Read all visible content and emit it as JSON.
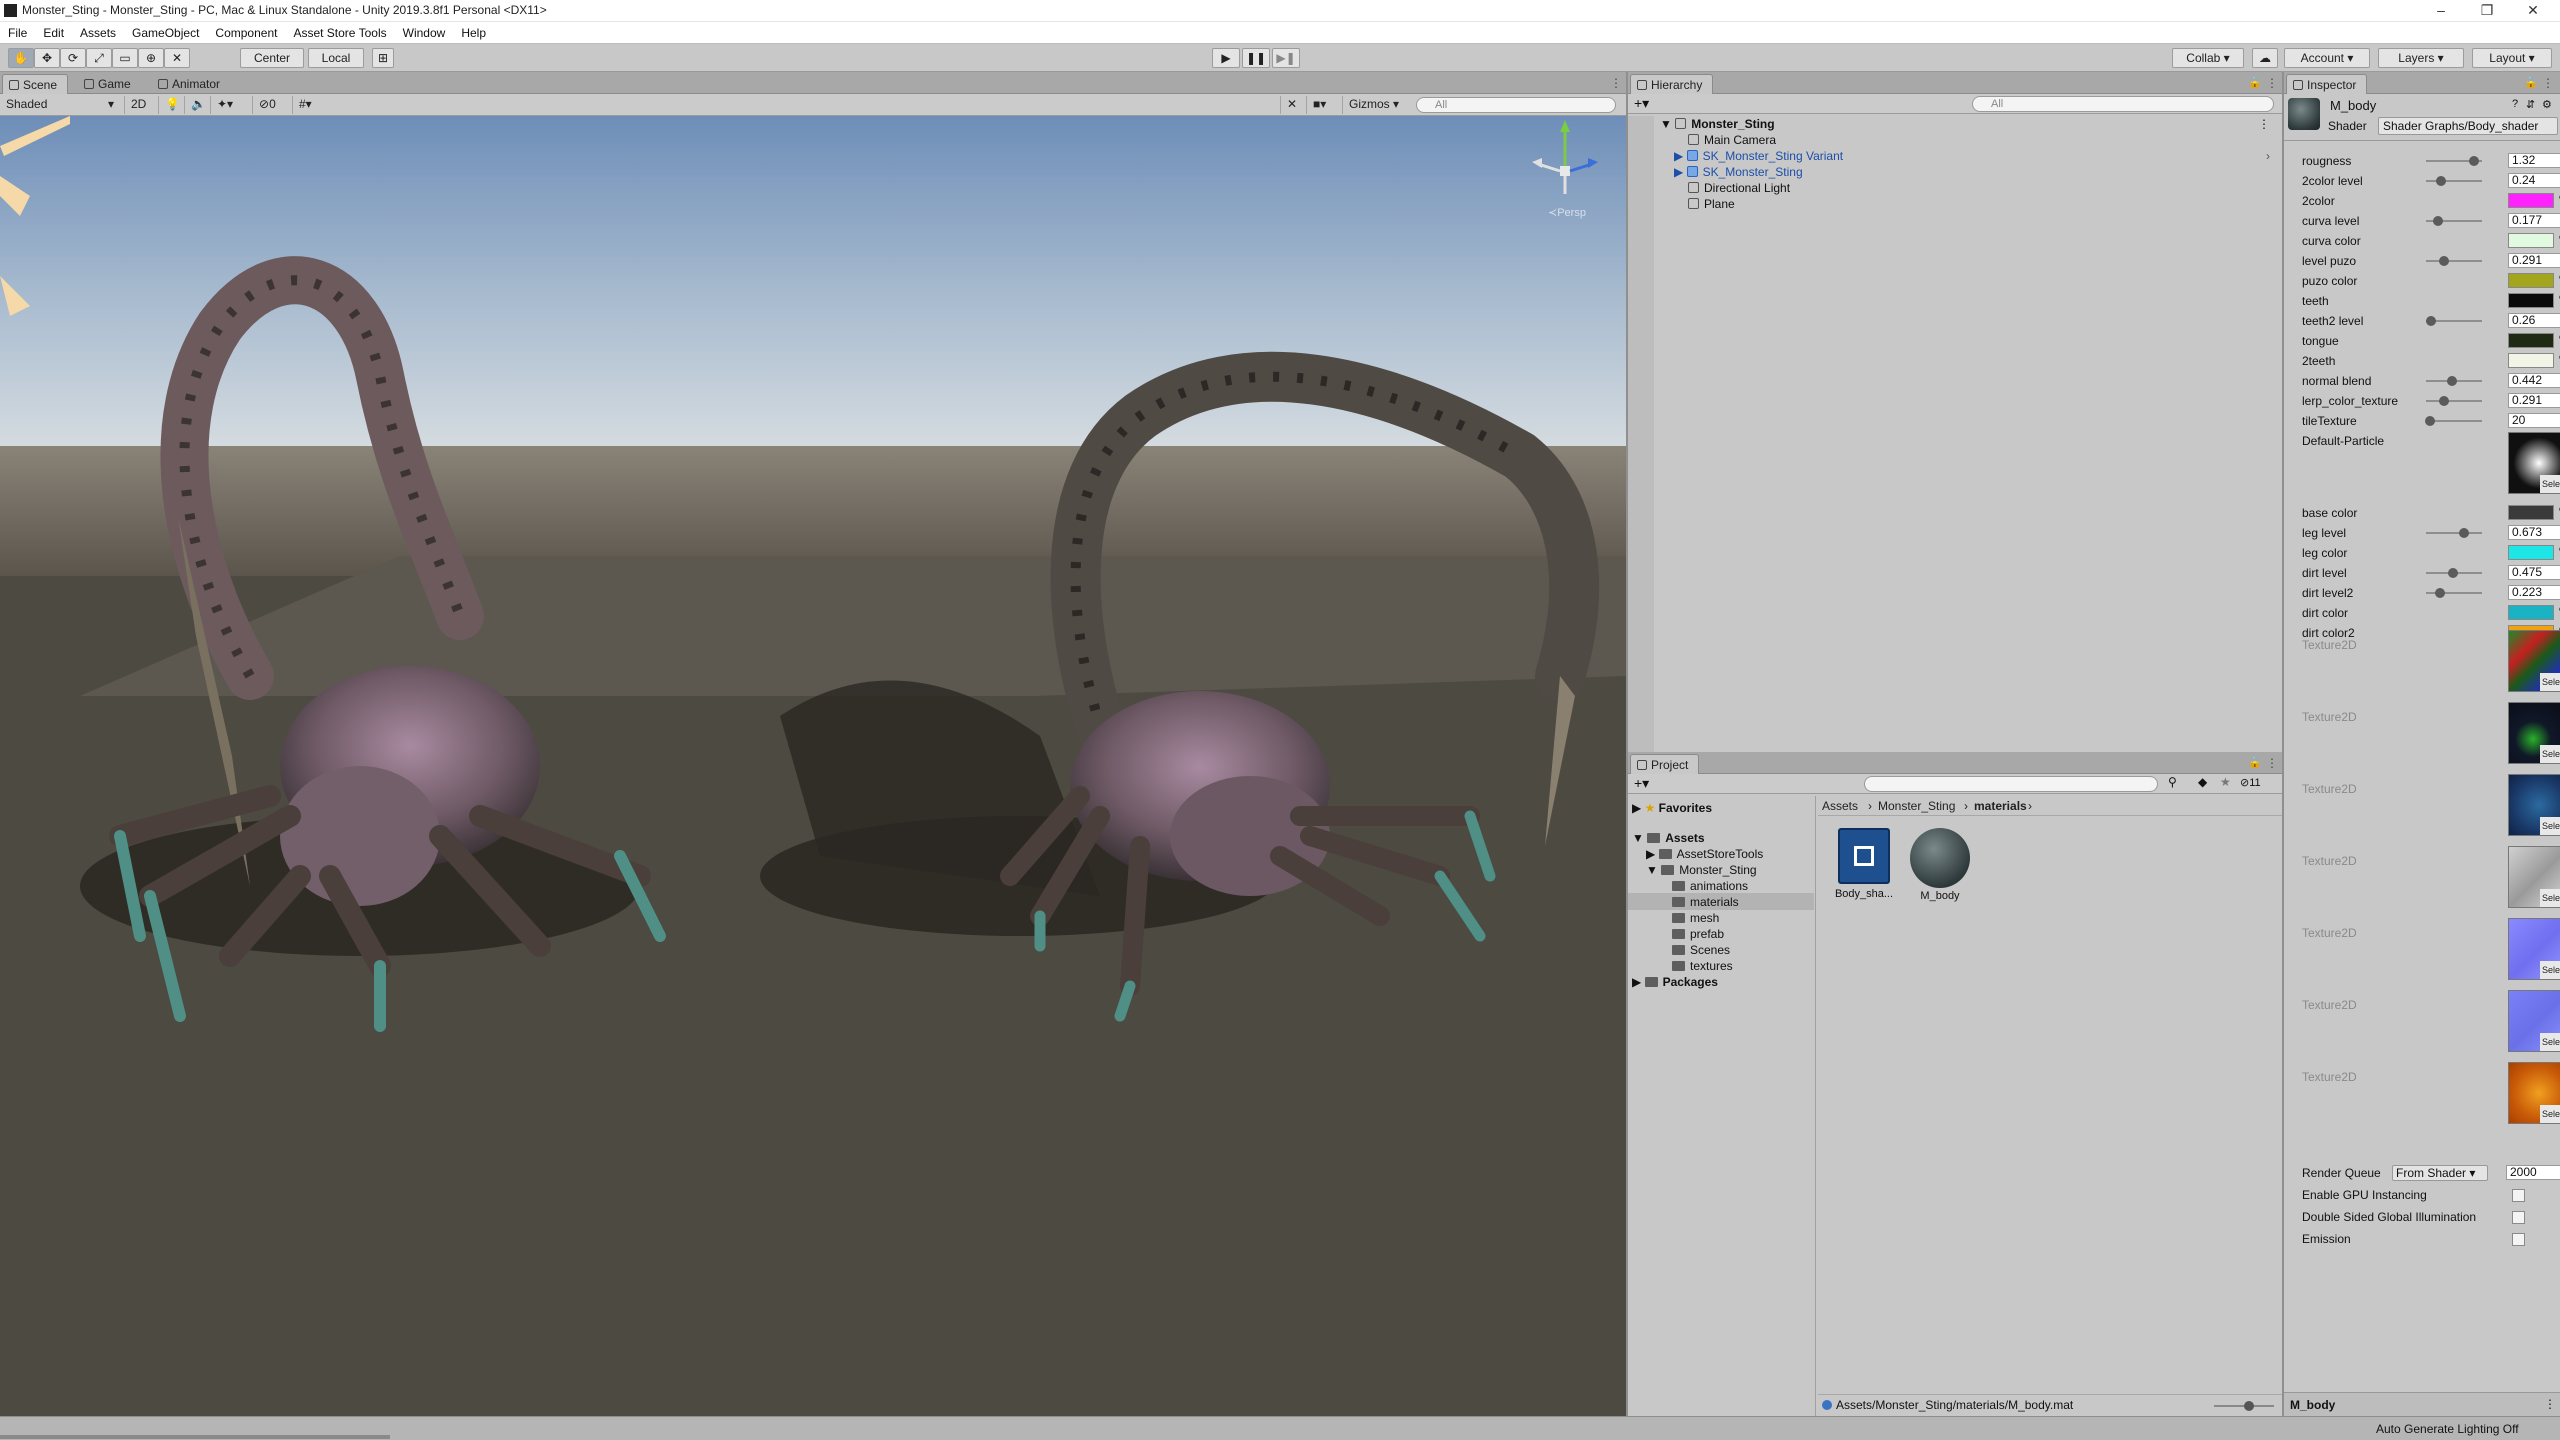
{
  "window": {
    "title": "Monster_Sting - Monster_Sting - PC, Mac & Linux Standalone - Unity 2019.3.8f1 Personal <DX11>",
    "controls": [
      "–",
      "❐",
      "✕"
    ]
  },
  "menu": [
    "File",
    "Edit",
    "Assets",
    "GameObject",
    "Component",
    "Asset Store Tools",
    "Window",
    "Help"
  ],
  "toolbar": {
    "pivot": "Center",
    "space": "Local",
    "collab": "Collab",
    "account": "Account",
    "layers": "Layers",
    "layout": "Layout"
  },
  "scene": {
    "tabs": [
      "Scene",
      "Game",
      "Animator"
    ],
    "shading": "Shaded",
    "mode2d": "2D",
    "fx_count": "0",
    "gizmos": "Gizmos",
    "search": "All",
    "persp": "≺Persp"
  },
  "hierarchy": {
    "tab": "Hierarchy",
    "search": "All",
    "root": "Monster_Sting",
    "items": [
      "Main Camera",
      "SK_Monster_Sting Variant",
      "SK_Monster_Sting",
      "Directional Light",
      "Plane"
    ]
  },
  "project": {
    "tab": "Project",
    "count": "11",
    "tree": {
      "favorites": "Favorites",
      "assets": "Assets",
      "asset_store_tools": "AssetStoreTools",
      "monster_sting": "Monster_Sting",
      "children": [
        "animations",
        "materials",
        "mesh",
        "prefab",
        "Scenes",
        "textures"
      ],
      "packages": "Packages"
    },
    "breadcrumb": [
      "Assets",
      "Monster_Sting",
      "materials"
    ],
    "files": [
      "Body_sha...",
      "M_body"
    ],
    "path": "Assets/Monster_Sting/materials/M_body.mat"
  },
  "inspector": {
    "tab": "Inspector",
    "name": "M_body",
    "shader_label": "Shader",
    "shader_value": "Shader Graphs/Body_shader",
    "props": [
      {
        "label": "rougness",
        "kind": "slider",
        "value": "1.32",
        "fraction": 0.86
      },
      {
        "label": "2color level",
        "kind": "slider",
        "value": "0.24",
        "fraction": 0.24
      },
      {
        "label": "2color",
        "kind": "color",
        "color": "#ff22ff"
      },
      {
        "label": "curva level",
        "kind": "slider",
        "value": "0.177",
        "fraction": 0.18
      },
      {
        "label": "curva color",
        "kind": "color",
        "color": "#e2fbe0"
      },
      {
        "label": "level puzo",
        "kind": "slider",
        "value": "0.291",
        "fraction": 0.29
      },
      {
        "label": "puzo color",
        "kind": "color",
        "color": "#a3a51c"
      },
      {
        "label": "teeth",
        "kind": "color",
        "color": "#0a0a0a"
      },
      {
        "label": "teeth2 level",
        "kind": "slider",
        "value": "0.26",
        "fraction": 0.03
      },
      {
        "label": "tongue",
        "kind": "color",
        "color": "#1f2a14"
      },
      {
        "label": "2teeth",
        "kind": "color",
        "color": "#f2f5e6"
      },
      {
        "label": "normal blend",
        "kind": "slider",
        "value": "0.442",
        "fraction": 0.44
      },
      {
        "label": "lerp_color_texture",
        "kind": "slider",
        "value": "0.291",
        "fraction": 0.29
      },
      {
        "label": "tileTexture",
        "kind": "slider",
        "value": "20",
        "fraction": 0.02
      },
      {
        "label": "Default-Particle",
        "kind": "texture",
        "texture": "particle"
      },
      {
        "label": "base color",
        "kind": "color",
        "color": "#3a3a3a"
      },
      {
        "label": "leg level",
        "kind": "slider",
        "value": "0.673",
        "fraction": 0.67
      },
      {
        "label": "leg color",
        "kind": "color",
        "color": "#1fe6e6"
      },
      {
        "label": "dirt level",
        "kind": "slider",
        "value": "0.475",
        "fraction": 0.47
      },
      {
        "label": "dirt level2",
        "kind": "slider",
        "value": "0.223",
        "fraction": 0.22
      },
      {
        "label": "dirt color",
        "kind": "color",
        "color": "#1ab3c4"
      },
      {
        "label": "dirt color2",
        "kind": "color",
        "color": "#f0a30f"
      }
    ],
    "textures": [
      {
        "label": "Texture2D",
        "texture": "rgb"
      },
      {
        "label": "Texture2D",
        "texture": "dark"
      },
      {
        "label": "Texture2D",
        "texture": "blue"
      },
      {
        "label": "Texture2D",
        "texture": "grey"
      },
      {
        "label": "Texture2D",
        "texture": "normal"
      },
      {
        "label": "Texture2D",
        "texture": "normal2"
      },
      {
        "label": "Texture2D",
        "texture": "orange"
      }
    ],
    "select_label": "Select",
    "render_queue_label": "Render Queue",
    "render_queue_mode": "From Shader",
    "render_queue_value": "2000",
    "gpu_instancing": "Enable GPU Instancing",
    "double_sided": "Double Sided Global Illumination",
    "emission": "Emission",
    "footer": "M_body"
  },
  "status": "Auto Generate Lighting Off",
  "colors": {
    "accent": "#3a72c4",
    "panel": "#c8c8c8",
    "tab_bar": "#a8a8a8"
  }
}
